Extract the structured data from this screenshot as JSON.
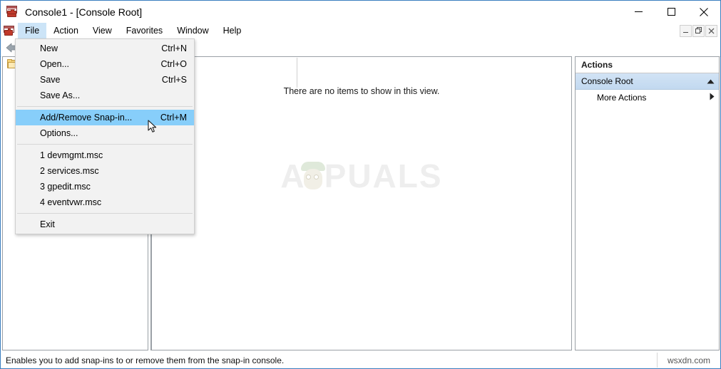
{
  "window": {
    "title": "Console1 - [Console Root]",
    "icon": "mmc-console-icon",
    "controls": {
      "minimize": "minimize-icon",
      "maximize": "maximize-icon",
      "close": "close-icon"
    },
    "mdi_controls": {
      "minimize": "–",
      "restore": "❐",
      "close": "✕"
    }
  },
  "menubar": {
    "items": [
      {
        "label": "File",
        "active": true
      },
      {
        "label": "Action",
        "active": false
      },
      {
        "label": "View",
        "active": false
      },
      {
        "label": "Favorites",
        "active": false
      },
      {
        "label": "Window",
        "active": false
      },
      {
        "label": "Help",
        "active": false
      }
    ]
  },
  "toolbar": {
    "back_icon": "back-arrow-icon"
  },
  "file_menu": {
    "rows": [
      {
        "type": "item",
        "label": "New",
        "shortcut": "Ctrl+N",
        "highlighted": false
      },
      {
        "type": "item",
        "label": "Open...",
        "shortcut": "Ctrl+O",
        "highlighted": false
      },
      {
        "type": "item",
        "label": "Save",
        "shortcut": "Ctrl+S",
        "highlighted": false
      },
      {
        "type": "item",
        "label": "Save As...",
        "shortcut": "",
        "highlighted": false
      },
      {
        "type": "separator"
      },
      {
        "type": "item",
        "label": "Add/Remove Snap-in...",
        "shortcut": "Ctrl+M",
        "highlighted": true
      },
      {
        "type": "item",
        "label": "Options...",
        "shortcut": "",
        "highlighted": false
      },
      {
        "type": "separator"
      },
      {
        "type": "item",
        "label": "1 devmgmt.msc",
        "shortcut": "",
        "highlighted": false
      },
      {
        "type": "item",
        "label": "2 services.msc",
        "shortcut": "",
        "highlighted": false
      },
      {
        "type": "item",
        "label": "3 gpedit.msc",
        "shortcut": "",
        "highlighted": false
      },
      {
        "type": "item",
        "label": "4 eventvwr.msc",
        "shortcut": "",
        "highlighted": false
      },
      {
        "type": "separator"
      },
      {
        "type": "item",
        "label": "Exit",
        "shortcut": "",
        "highlighted": false
      }
    ]
  },
  "tree": {
    "root_label": "",
    "root_icon": "folder-icon"
  },
  "content": {
    "empty_message": "There are no items to show in this view.",
    "watermark": "APPUALS"
  },
  "actions": {
    "header": "Actions",
    "group": {
      "label": "Console Root",
      "chevron": "chevron-up-icon"
    },
    "items": [
      {
        "label": "More Actions",
        "arrow": "chevron-right-icon"
      }
    ]
  },
  "statusbar": {
    "message": "Enables you to add snap-ins to or remove them from the snap-in console.",
    "watermark": "wsxdn.com"
  },
  "colors": {
    "menu_highlight": "#87cefa",
    "menubar_active": "#cce4f7",
    "actions_group_bg": "#c8dcf0",
    "window_border": "#3a7ebf",
    "pane_border": "#9aa0a6"
  }
}
